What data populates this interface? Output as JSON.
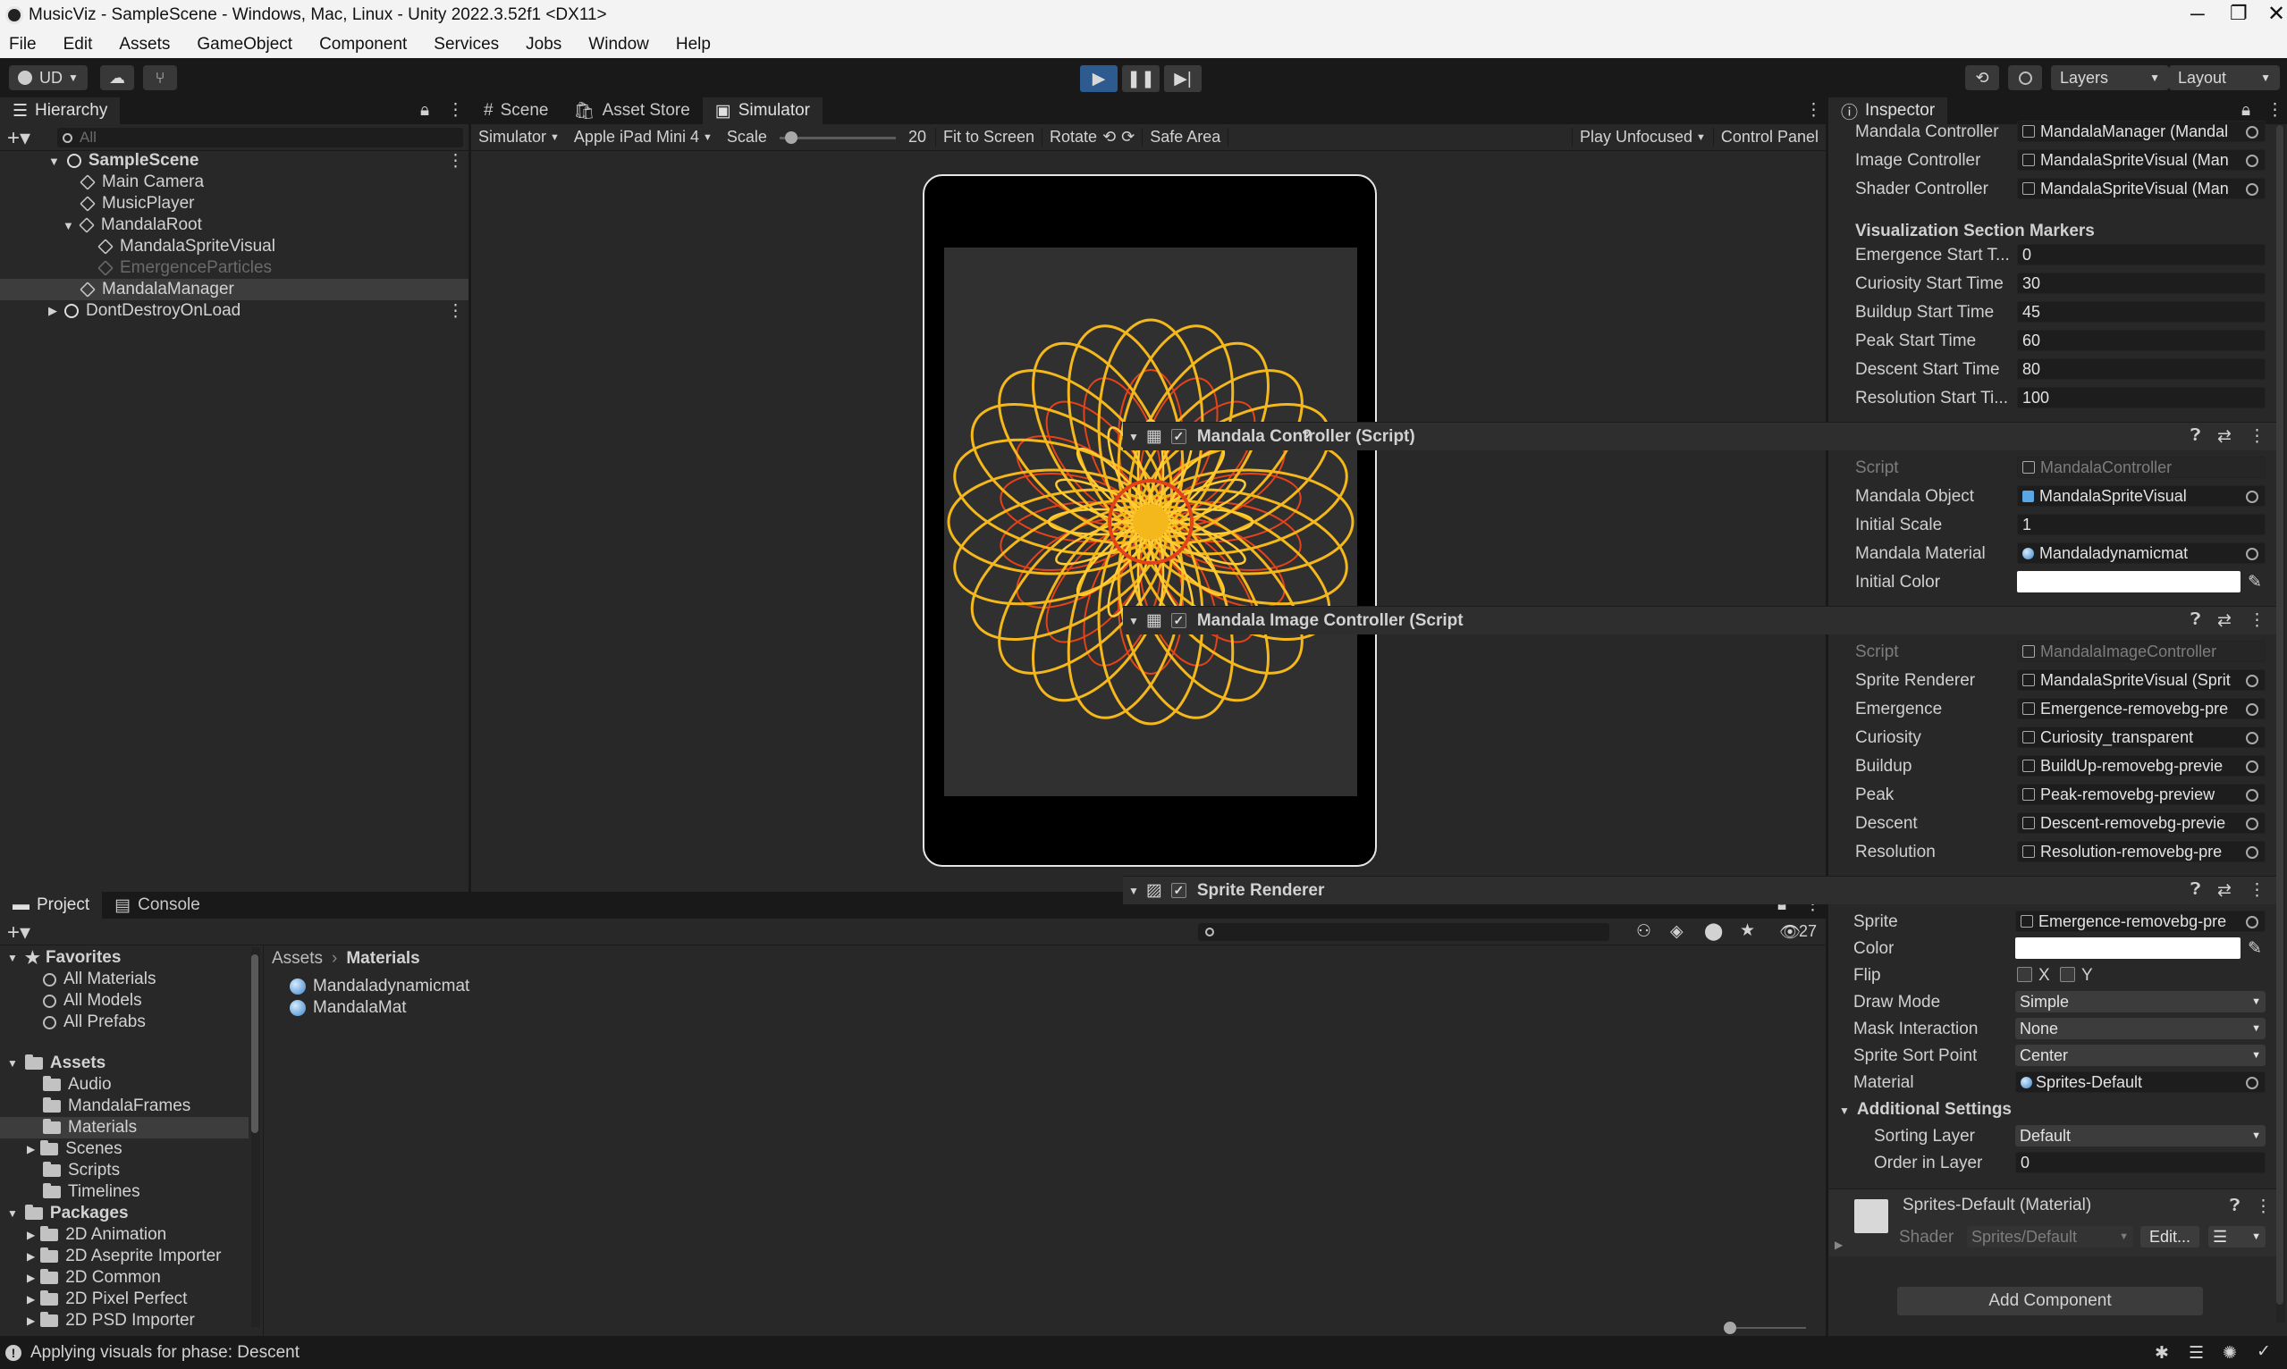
{
  "window": {
    "title": "MusicViz - SampleScene - Windows, Mac, Linux - Unity 2022.3.52f1 <DX11>"
  },
  "menu": [
    "File",
    "Edit",
    "Assets",
    "GameObject",
    "Component",
    "Services",
    "Jobs",
    "Window",
    "Help"
  ],
  "toolbar": {
    "account": "UD",
    "layers": "Layers",
    "layout": "Layout"
  },
  "hierarchy": {
    "title": "Hierarchy",
    "search_placeholder": "All",
    "items": [
      "SampleScene",
      "Main Camera",
      "MusicPlayer",
      "MandalaRoot",
      "MandalaSpriteVisual",
      "EmergenceParticles",
      "MandalaManager",
      "DontDestroyOnLoad"
    ]
  },
  "scene_tabs": [
    "Scene",
    "Asset Store",
    "Simulator"
  ],
  "simulator": {
    "mode": "Simulator",
    "device": "Apple iPad Mini 4",
    "scale_label": "Scale",
    "scale_value": "20",
    "fit": "Fit to Screen",
    "rotate": "Rotate",
    "safe_area": "Safe Area",
    "play_mode": "Play Unfocused",
    "control_panel": "Control Panel",
    "scale_fraction": 0.05
  },
  "project": {
    "tabs": [
      "Project",
      "Console"
    ],
    "count": "27",
    "breadcrumb": [
      "Assets",
      "Materials"
    ],
    "favorites_title": "Favorites",
    "favorites": [
      "All Materials",
      "All Models",
      "All Prefabs"
    ],
    "assets_title": "Assets",
    "assets": [
      "Audio",
      "MandalaFrames",
      "Materials",
      "Scenes",
      "Scripts",
      "Timelines"
    ],
    "packages_title": "Packages",
    "packages": [
      "2D Animation",
      "2D Aseprite Importer",
      "2D Common",
      "2D Pixel Perfect",
      "2D PSD Importer"
    ],
    "files": [
      "Mandaladynamicmat",
      "MandalaMat"
    ]
  },
  "status": {
    "message": "Applying visuals for phase: Descent"
  },
  "inspector": {
    "title": "Inspector",
    "top_fields": [
      {
        "label": "Mandala Controller",
        "value": "MandalaManager (Mandal"
      },
      {
        "label": "Image Controller",
        "value": "MandalaSpriteVisual (Man"
      },
      {
        "label": "Shader Controller",
        "value": "MandalaSpriteVisual (Man"
      }
    ],
    "markers_title": "Visualization Section Markers",
    "markers": [
      {
        "label": "Emergence Start T...",
        "value": "0"
      },
      {
        "label": "Curiosity Start Time",
        "value": "30"
      },
      {
        "label": "Buildup Start Time",
        "value": "45"
      },
      {
        "label": "Peak Start Time",
        "value": "60"
      },
      {
        "label": "Descent Start Time",
        "value": "80"
      },
      {
        "label": "Resolution Start Ti...",
        "value": "100"
      }
    ],
    "mandala_controller": {
      "title": "Mandala Controller (Script)",
      "fields": [
        {
          "label": "Script",
          "value": "MandalaController"
        },
        {
          "label": "Mandala Object",
          "value": "MandalaSpriteVisual"
        },
        {
          "label": "Initial Scale",
          "value": "1"
        },
        {
          "label": "Mandala Material",
          "value": "Mandaladynamicmat"
        },
        {
          "label": "Initial Color",
          "value": ""
        }
      ]
    },
    "image_controller": {
      "title": "Mandala Image Controller (Script",
      "fields": [
        {
          "label": "Script",
          "value": "MandalaImageController"
        },
        {
          "label": "Sprite Renderer",
          "value": "MandalaSpriteVisual (Sprit"
        },
        {
          "label": "Emergence",
          "value": "Emergence-removebg-pre"
        },
        {
          "label": "Curiosity",
          "value": "Curiosity_transparent"
        },
        {
          "label": "Buildup",
          "value": "BuildUp-removebg-previe"
        },
        {
          "label": "Peak",
          "value": "Peak-removebg-preview"
        },
        {
          "label": "Descent",
          "value": "Descent-removebg-previe"
        },
        {
          "label": "Resolution",
          "value": "Resolution-removebg-pre"
        }
      ]
    },
    "sprite_renderer": {
      "title": "Sprite Renderer",
      "sprite_label": "Sprite",
      "sprite": "Emergence-removebg-pre",
      "color_label": "Color",
      "flip_label": "Flip",
      "flip_x": "X",
      "flip_y": "Y",
      "draw_mode_label": "Draw Mode",
      "draw_mode": "Simple",
      "mask_label": "Mask Interaction",
      "mask": "None",
      "sort_point_label": "Sprite Sort Point",
      "sort_point": "Center",
      "material_label": "Material",
      "material": "Sprites-Default",
      "additional_title": "Additional Settings",
      "sorting_layer_label": "Sorting Layer",
      "sorting_layer": "Default",
      "order_label": "Order in Layer",
      "order": "0"
    },
    "material": {
      "title": "Sprites-Default (Material)",
      "shader_label": "Shader",
      "shader": "Sprites/Default",
      "edit": "Edit..."
    },
    "add_component": "Add Component"
  },
  "colors": {
    "accent_play": "#2d5b8f",
    "mandala_gold": "#f4b81c",
    "mandala_red": "#e4431a"
  }
}
